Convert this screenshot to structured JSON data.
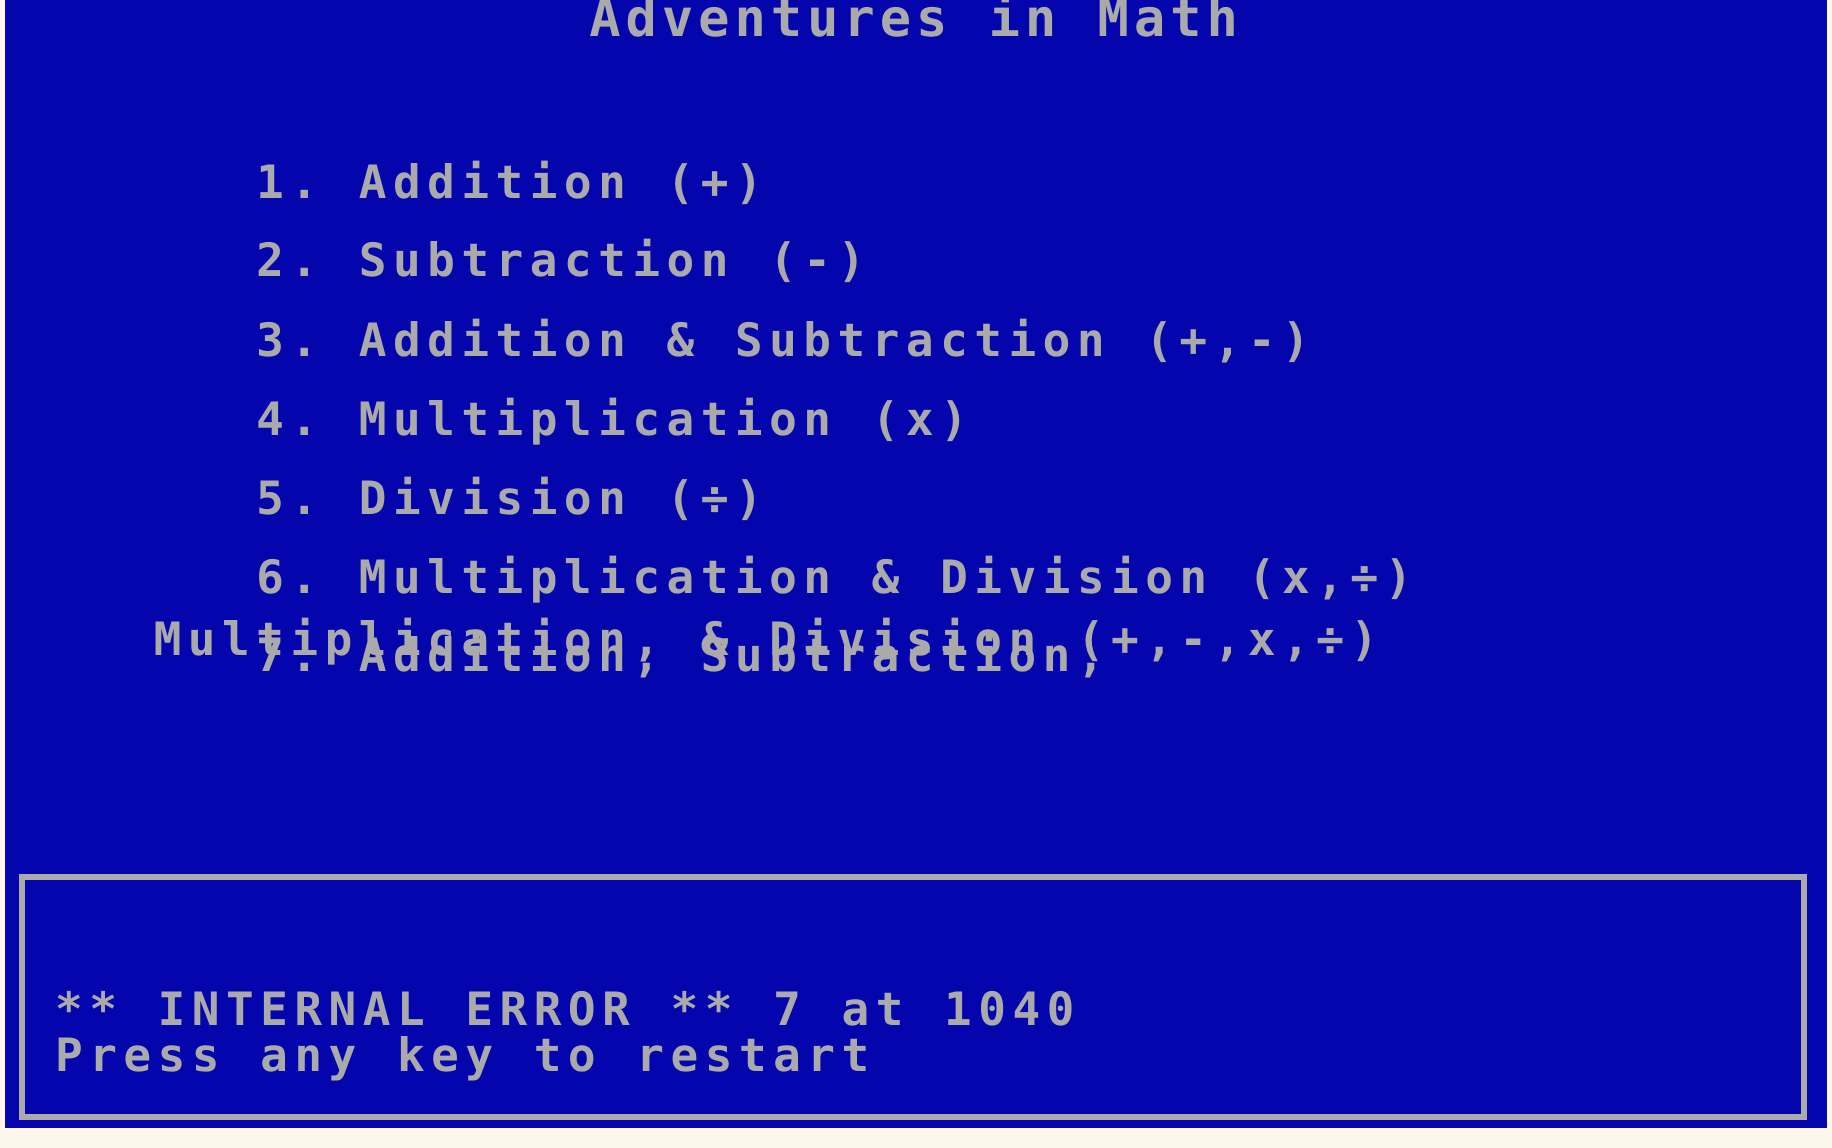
{
  "app": {
    "title": "Adventures in Math",
    "background_color": "#0505ad",
    "text_color": "#aaaaaa",
    "page_margin_color": "#fdf6ec"
  },
  "menu": {
    "items": [
      {
        "number": "1.",
        "label": "Addition (+)",
        "operators": "(+)"
      },
      {
        "number": "2.",
        "label": "Subtraction (-)",
        "operators": "(-)"
      },
      {
        "number": "3.",
        "label": "Addition & Subtraction (+,-)",
        "operators": "(+,-)"
      },
      {
        "number": "4.",
        "label": "Multiplication (x)",
        "operators": "(x)"
      },
      {
        "number": "5.",
        "label": "Division (÷)",
        "operators": "(÷)"
      },
      {
        "number": "6.",
        "label": "Multiplication & Division (x,÷)",
        "operators": "(x,÷)"
      },
      {
        "number": "7.",
        "label": "Addition, Subtraction,",
        "label_wrap": "Multiplication, & Division (+,-,x,÷)",
        "operators": "(+,-,x,÷)"
      }
    ]
  },
  "error_box": {
    "border_color": "#aaaaaa",
    "line_1": "** INTERNAL ERROR ** 7 at 1040",
    "line_2": "Press any key to restart",
    "error_code": "7",
    "error_line_number": "1040"
  }
}
